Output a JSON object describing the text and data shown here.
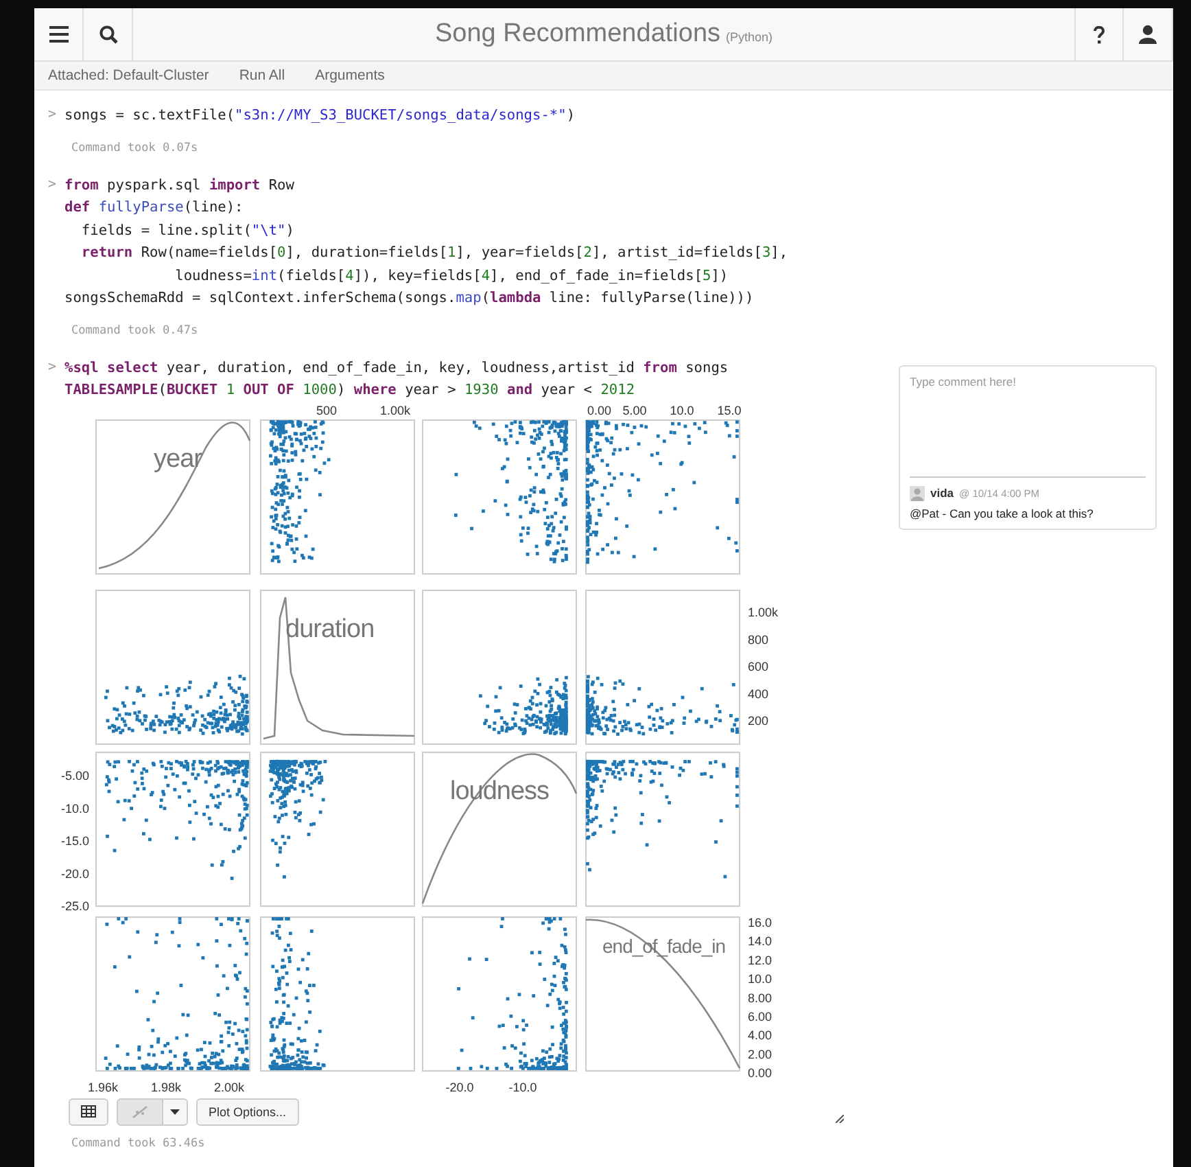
{
  "toolbar": {
    "title": "Song Recommendations",
    "language": "(Python)"
  },
  "subbar": {
    "cluster": "Attached: Default-Cluster",
    "links": [
      "Run All",
      "Arguments"
    ]
  },
  "cells": [
    {
      "prompt": ">",
      "lines": [
        [
          {
            "text": "songs = sc.textFile(",
            "kind": "plain"
          },
          {
            "text": "\"s3n://MY_S3_BUCKET/songs_data/songs-*\"",
            "kind": "str"
          },
          {
            "text": ")",
            "kind": "plain"
          }
        ]
      ],
      "status": "Command took 0.07s"
    },
    {
      "prompt": ">",
      "lines": [
        [
          {
            "text": "from",
            "kind": "kw"
          },
          {
            "text": " pyspark.sql ",
            "kind": "plain"
          },
          {
            "text": "import",
            "kind": "kw"
          },
          {
            "text": " Row",
            "kind": "plain"
          }
        ],
        [
          {
            "text": "def ",
            "kind": "kw"
          },
          {
            "text": "fullyParse",
            "kind": "fn"
          },
          {
            "text": "(line):",
            "kind": "plain"
          }
        ],
        [
          {
            "text": "  fields = line.split(",
            "kind": "plain"
          },
          {
            "text": "\"\\t\"",
            "kind": "str"
          },
          {
            "text": ")",
            "kind": "plain"
          }
        ],
        [
          {
            "text": "  return",
            "kind": "kw"
          },
          {
            "text": " Row(name=fields[",
            "kind": "plain"
          },
          {
            "text": "0",
            "kind": "num"
          },
          {
            "text": "], duration=fields[",
            "kind": "plain"
          },
          {
            "text": "1",
            "kind": "num"
          },
          {
            "text": "], year=fields[",
            "kind": "plain"
          },
          {
            "text": "2",
            "kind": "num"
          },
          {
            "text": "], artist_id=fields[",
            "kind": "plain"
          },
          {
            "text": "3",
            "kind": "num"
          },
          {
            "text": "],",
            "kind": "plain"
          }
        ],
        [
          {
            "text": "             loudness=",
            "kind": "plain"
          },
          {
            "text": "int",
            "kind": "fn"
          },
          {
            "text": "(fields[",
            "kind": "plain"
          },
          {
            "text": "4",
            "kind": "num"
          },
          {
            "text": "]), key=fields[",
            "kind": "plain"
          },
          {
            "text": "4",
            "kind": "num"
          },
          {
            "text": "], end_of_fade_in=fields[",
            "kind": "plain"
          },
          {
            "text": "5",
            "kind": "num"
          },
          {
            "text": "])",
            "kind": "plain"
          }
        ],
        [
          {
            "text": "songsSchemaRdd = sqlContext.inferSchema(songs.",
            "kind": "plain"
          },
          {
            "text": "map",
            "kind": "fn"
          },
          {
            "text": "(",
            "kind": "plain"
          },
          {
            "text": "lambda",
            "kind": "kw"
          },
          {
            "text": " line: fullyParse(line)))",
            "kind": "plain"
          }
        ]
      ],
      "status": "Command took 0.47s"
    },
    {
      "prompt": ">",
      "lines": [
        [
          {
            "text": "%sql select",
            "kind": "kw"
          },
          {
            "text": " year, duration, end_of_fade_in, key, loudness,artist_id ",
            "kind": "plain"
          },
          {
            "text": "from",
            "kind": "kw"
          },
          {
            "text": " songs",
            "kind": "plain"
          }
        ],
        [
          {
            "text": "TABLESAMPLE",
            "kind": "kw"
          },
          {
            "text": "(",
            "kind": "plain"
          },
          {
            "text": "BUCKET ",
            "kind": "kw"
          },
          {
            "text": "1",
            "kind": "num"
          },
          {
            "text": " OUT OF ",
            "kind": "kw"
          },
          {
            "text": "1000",
            "kind": "num"
          },
          {
            "text": ") ",
            "kind": "plain"
          },
          {
            "text": "where",
            "kind": "kw"
          },
          {
            "text": " year > ",
            "kind": "plain"
          },
          {
            "text": "1930",
            "kind": "num"
          },
          {
            "text": " and",
            "kind": "kw"
          },
          {
            "text": " year < ",
            "kind": "plain"
          },
          {
            "text": "2012",
            "kind": "num"
          }
        ]
      ],
      "status": "Command took 63.46s"
    }
  ],
  "plot": {
    "variables": [
      "year",
      "duration",
      "loudness",
      "end_of_fade_in"
    ],
    "top_ticks_duration": [
      "500",
      "1.00k"
    ],
    "top_ticks_end_of_fade_in": [
      "0.00",
      "5.00",
      "10.0",
      "15.0"
    ],
    "right_ticks_duration": [
      "1.00k",
      "800",
      "600",
      "400",
      "200"
    ],
    "left_ticks_loudness": [
      "-5.00",
      "-10.0",
      "-15.0",
      "-20.0",
      "-25.0"
    ],
    "right_ticks_end_of_fade_in": [
      "16.0",
      "14.0",
      "12.0",
      "10.0",
      "8.00",
      "6.00",
      "4.00",
      "2.00",
      "0.00"
    ],
    "bottom_ticks_year": [
      "1.96k",
      "1.98k",
      "2.00k"
    ],
    "bottom_ticks_loudness": [
      "-20.0",
      "-10.0"
    ]
  },
  "plot_controls": {
    "chart_selected": true,
    "options_label": "Plot Options..."
  },
  "comment": {
    "placeholder": "Type comment here!",
    "author": "vida",
    "time": "@ 10/14 4:00 PM",
    "text": "@Pat - Can you take a look at this?"
  }
}
